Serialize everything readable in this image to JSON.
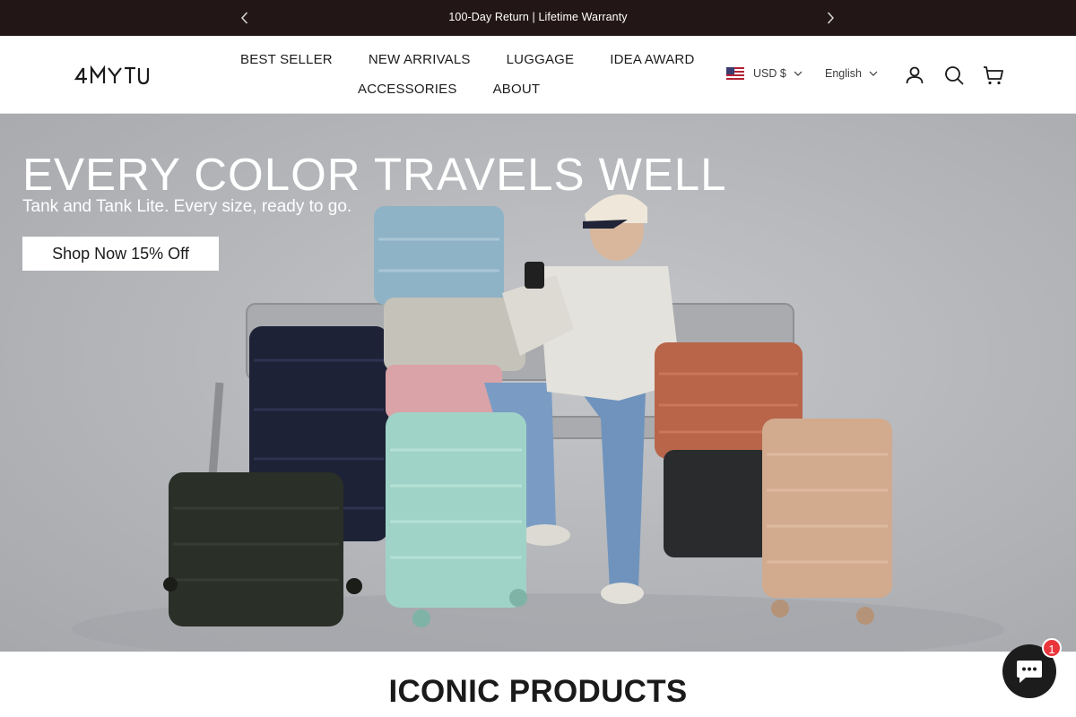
{
  "announcement": {
    "text": "100-Day Return | Lifetime Warranty"
  },
  "header": {
    "logo_text": "4MYTU",
    "nav_row1": [
      "BEST SELLER",
      "NEW ARRIVALS",
      "LUGGAGE",
      "IDEA AWARD"
    ],
    "nav_row2": [
      "ACCESSORIES",
      "ABOUT"
    ],
    "currency": "USD $",
    "language": "English",
    "icons": [
      "account-icon",
      "search-icon",
      "cart-icon"
    ]
  },
  "hero": {
    "title": "EVERY COLOR TRAVELS WELL",
    "subtitle": "Tank and Tank Lite. Every size, ready to go.",
    "cta": "Shop Now 15% Off"
  },
  "section": {
    "title": "ICONIC PRODUCTS"
  },
  "chat": {
    "badge_count": "1"
  },
  "colors": {
    "announcement_bg": "#231617",
    "hero_bg": "#b3b5b9",
    "chat_bg": "#1c1c1c",
    "badge": "#e8363c",
    "luggage": [
      "#8fb3c6",
      "#1d2236",
      "#c5c2b9",
      "#d9a3a8",
      "#9fd3c7",
      "#2a2f27",
      "#b8654a",
      "#2a2b2c",
      "#d2aa8d"
    ]
  }
}
